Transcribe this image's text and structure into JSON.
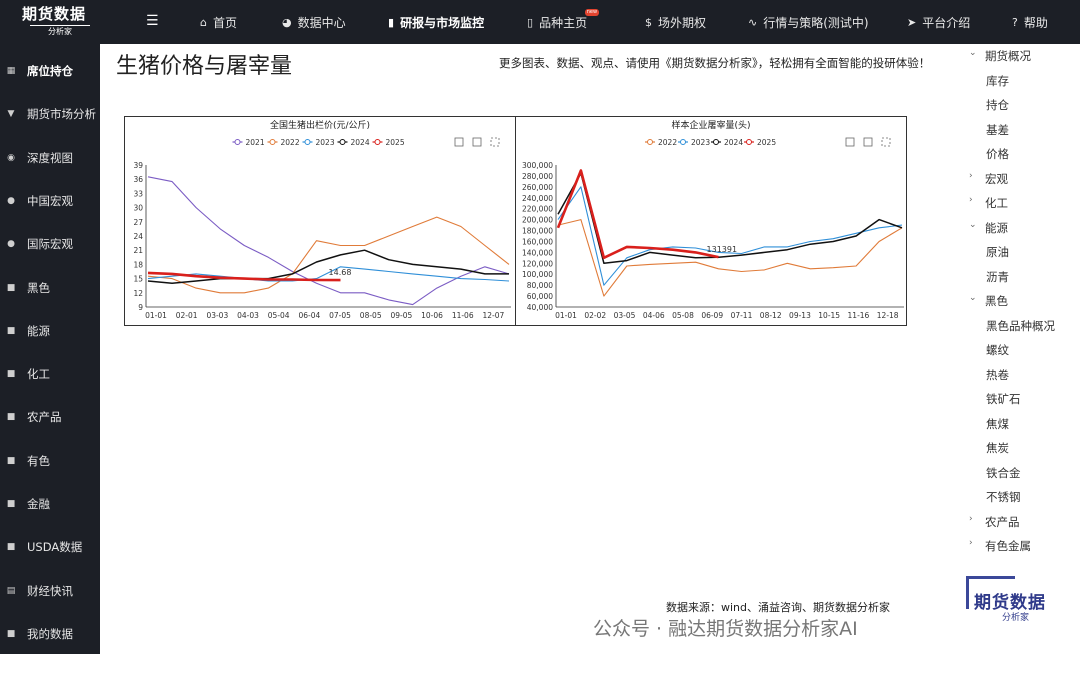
{
  "header": {
    "logo_title": "期货数据",
    "logo_subtitle": "分析家",
    "nav": [
      {
        "label": "首页",
        "icon": "home-icon",
        "glyph": "⌂"
      },
      {
        "label": "数据中心",
        "icon": "pie-chart-icon",
        "glyph": "◕"
      },
      {
        "label": "研报与市场监控",
        "icon": "bar-chart-icon",
        "glyph": "▮"
      },
      {
        "label": "品种主页",
        "icon": "book-icon",
        "glyph": "▯",
        "badge": "new"
      },
      {
        "label": "场外期权",
        "icon": "dollar-icon",
        "glyph": "$"
      },
      {
        "label": "行情与策略(测试中)",
        "icon": "pulse-icon",
        "glyph": "∿"
      },
      {
        "label": "平台介绍",
        "icon": "send-icon",
        "glyph": "➤"
      },
      {
        "label": "帮助",
        "icon": "help-icon",
        "glyph": "?"
      }
    ]
  },
  "sidebar": {
    "items": [
      {
        "label": "席位持仓",
        "icon": "grid-icon",
        "glyph": "▦"
      },
      {
        "label": "期货市场分析",
        "icon": "filter-icon",
        "glyph": "▼"
      },
      {
        "label": "深度视图",
        "icon": "eye-icon",
        "glyph": "◉"
      },
      {
        "label": "中国宏观",
        "icon": "globe-icon",
        "glyph": "●"
      },
      {
        "label": "国际宏观",
        "icon": "globe-icon",
        "glyph": "●"
      },
      {
        "label": "黑色",
        "icon": "cube-icon",
        "glyph": "■"
      },
      {
        "label": "能源",
        "icon": "cube-icon",
        "glyph": "■"
      },
      {
        "label": "化工",
        "icon": "cube-icon",
        "glyph": "■"
      },
      {
        "label": "农产品",
        "icon": "cube-icon",
        "glyph": "■"
      },
      {
        "label": "有色",
        "icon": "cube-icon",
        "glyph": "■"
      },
      {
        "label": "金融",
        "icon": "cube-icon",
        "glyph": "■"
      },
      {
        "label": "USDA数据",
        "icon": "cube-icon",
        "glyph": "■"
      },
      {
        "label": "财经快讯",
        "icon": "news-icon",
        "glyph": "▤"
      },
      {
        "label": "我的数据",
        "icon": "cube-icon",
        "glyph": "■"
      }
    ]
  },
  "main": {
    "title": "生猪价格与屠宰量",
    "promo": "更多图表、数据、观点、请使用《期货数据分析家》，轻松拥有全面智能的投研体验！",
    "source": "数据来源：wind、涌益咨询、期货数据分析家",
    "watermark": "公众号 · 融达期货数据分析家AI",
    "watermark_logo_title": "期货数据",
    "watermark_logo_sub": "分析家"
  },
  "tree": [
    {
      "label": "期货概况",
      "level": 0,
      "caret": "down"
    },
    {
      "label": "库存",
      "level": 1
    },
    {
      "label": "持仓",
      "level": 1
    },
    {
      "label": "基差",
      "level": 1
    },
    {
      "label": "价格",
      "level": 1
    },
    {
      "label": "宏观",
      "level": 0,
      "caret": "right"
    },
    {
      "label": "化工",
      "level": 0,
      "caret": "right"
    },
    {
      "label": "能源",
      "level": 0,
      "caret": "down"
    },
    {
      "label": "原油",
      "level": 1
    },
    {
      "label": "沥青",
      "level": 1
    },
    {
      "label": "黑色",
      "level": 0,
      "caret": "down"
    },
    {
      "label": "黑色品种概况",
      "level": 1
    },
    {
      "label": "螺纹",
      "level": 1
    },
    {
      "label": "热卷",
      "level": 1
    },
    {
      "label": "铁矿石",
      "level": 1
    },
    {
      "label": "焦煤",
      "level": 1
    },
    {
      "label": "焦炭",
      "level": 1
    },
    {
      "label": "铁合金",
      "level": 1
    },
    {
      "label": "不锈钢",
      "level": 1
    },
    {
      "label": "农产品",
      "level": 0,
      "caret": "right"
    },
    {
      "label": "有色金属",
      "level": 0,
      "caret": "right"
    }
  ],
  "chart_data": [
    {
      "type": "line",
      "title": "全国生猪出栏价(元/公斤)",
      "categories": [
        "01-01",
        "02-01",
        "03-03",
        "04-03",
        "05-04",
        "06-04",
        "07-05",
        "08-05",
        "09-05",
        "10-06",
        "11-06",
        "12-07"
      ],
      "ylim": [
        9,
        39
      ],
      "yticks": [
        9,
        12,
        15,
        18,
        21,
        24,
        27,
        30,
        33,
        36,
        39
      ],
      "grid": false,
      "legend": "top-center",
      "annotation": "14.68",
      "series": [
        {
          "name": "2021",
          "color": "#7b5cc4",
          "values": [
            36.5,
            35.5,
            30,
            25.5,
            22,
            19.5,
            16.5,
            14,
            12,
            12,
            10.5,
            9.5,
            13,
            15.5,
            17.5,
            16
          ]
        },
        {
          "name": "2022",
          "color": "#e07b39",
          "values": [
            15.5,
            15,
            13,
            12,
            12,
            13,
            16,
            23,
            22,
            22,
            24,
            26,
            28,
            26,
            22,
            18
          ]
        },
        {
          "name": "2023",
          "color": "#2f8fd8",
          "values": [
            15,
            15.5,
            16,
            15.5,
            15,
            14.5,
            14.5,
            15,
            17.5,
            17,
            16.5,
            16,
            15.5,
            15,
            14.8,
            14.5
          ]
        },
        {
          "name": "2024",
          "color": "#111111",
          "values": [
            14.5,
            14,
            14.5,
            15,
            15,
            15,
            16,
            18.5,
            20,
            21,
            19,
            18,
            17.5,
            17,
            16,
            16
          ]
        },
        {
          "name": "2025",
          "color": "#d9201c",
          "values": [
            16.2,
            16,
            15.5,
            15.2,
            15,
            14.8,
            14.8,
            14.7,
            14.68
          ]
        }
      ]
    },
    {
      "type": "line",
      "title": "样本企业屠宰量(头)",
      "categories": [
        "01-01",
        "02-02",
        "03-05",
        "04-06",
        "05-08",
        "06-09",
        "07-11",
        "08-12",
        "09-13",
        "10-15",
        "11-16",
        "12-18"
      ],
      "ylim": [
        40000,
        300000
      ],
      "yticks": [
        "40,000",
        "60,000",
        "80,000",
        "100,000",
        "120,000",
        "140,000",
        "160,000",
        "180,000",
        "200,000",
        "220,000",
        "240,000",
        "260,000",
        "280,000",
        "300,000"
      ],
      "grid": false,
      "legend": "top-center",
      "annotation": "131391",
      "series": [
        {
          "name": "2022",
          "color": "#e07b39",
          "values": [
            190000,
            200000,
            60000,
            115000,
            118000,
            120000,
            122000,
            110000,
            105000,
            108000,
            120000,
            110000,
            112000,
            115000,
            160000,
            185000
          ]
        },
        {
          "name": "2023",
          "color": "#2f8fd8",
          "values": [
            200000,
            260000,
            80000,
            130000,
            145000,
            150000,
            148000,
            140000,
            138000,
            150000,
            150000,
            160000,
            165000,
            175000,
            185000,
            190000
          ]
        },
        {
          "name": "2024",
          "color": "#111111",
          "values": [
            210000,
            285000,
            120000,
            125000,
            140000,
            135000,
            130000,
            131000,
            135000,
            140000,
            145000,
            155000,
            160000,
            170000,
            200000,
            185000
          ]
        },
        {
          "name": "2025",
          "color": "#d9201c",
          "values": [
            185000,
            290000,
            130000,
            150000,
            148000,
            145000,
            140000,
            131391
          ]
        }
      ]
    }
  ]
}
